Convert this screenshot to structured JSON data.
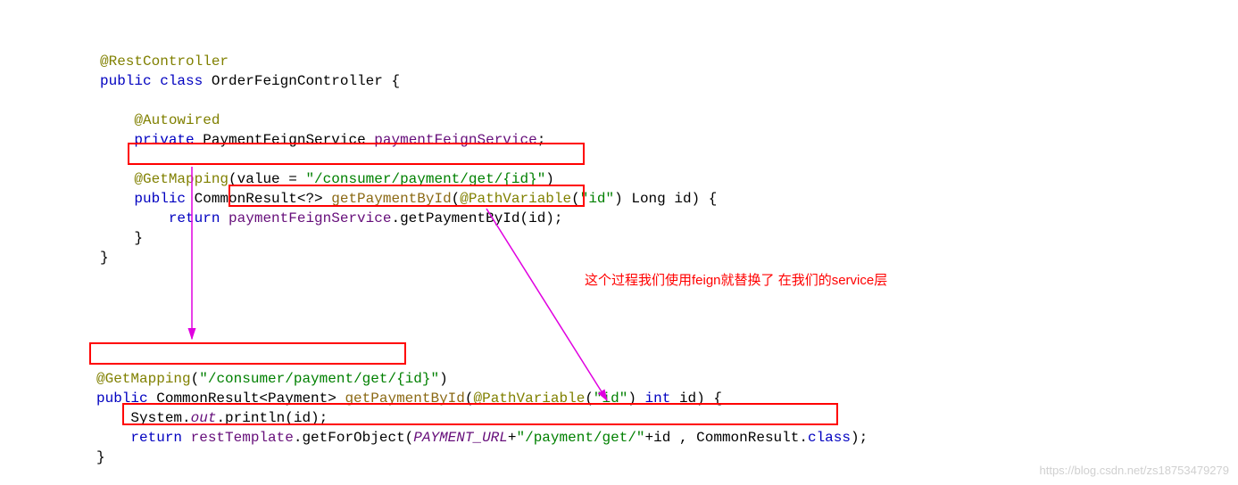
{
  "code1": {
    "line1": {
      "annotation": "@RestController"
    },
    "line2": {
      "kw1": "public",
      "kw2": "class",
      "name": "OrderFeignController",
      "brace": "{"
    },
    "line4": {
      "annotation": "@Autowired"
    },
    "line5": {
      "kw1": "private",
      "type": "PaymentFeignService",
      "field": "paymentFeignService",
      "semi": ";"
    },
    "line7": {
      "annotation": "@GetMapping",
      "paren1": "(",
      "param": "value = ",
      "string": "\"/consumer/payment/get/{id}\"",
      "paren2": ")"
    },
    "line8": {
      "kw1": "public",
      "type": "CommonResult<?> ",
      "method": "getPaymentById",
      "paren1": "(",
      "annotation": "@PathVariable",
      "pparen1": "(",
      "pstring": "\"id\"",
      "pparen2": ")",
      "argtype": " Long ",
      "argname": "id",
      "paren2": ") {"
    },
    "line9": {
      "kw1": "return",
      "sp": " ",
      "field": "paymentFeignService",
      "call": ".getPaymentById(id);"
    },
    "line10": {
      "brace": "}"
    },
    "line11": {
      "brace": "}"
    }
  },
  "comment": "这个过程我们使用feign就替换了 在我们的service层",
  "code2": {
    "line1": {
      "annotation": "@GetMapping",
      "paren1": "(",
      "string": "\"/consumer/payment/get/{id}\"",
      "paren2": ")"
    },
    "line2": {
      "kw1": "public",
      "type": " CommonResult<Payment> ",
      "method": "getPaymentById",
      "paren1": "(",
      "annotation": "@PathVariable",
      "pparen1": "(",
      "pstring": "\"id\"",
      "pparen2": ")",
      "kw2": " int ",
      "argname": "id",
      "paren2": ") {"
    },
    "line3": {
      "prefix": "System.",
      "out": "out",
      "call": ".println(id);"
    },
    "line4": {
      "kw1": "return",
      "sp": " ",
      "field": "restTemplate",
      "call1": ".getForObject(",
      "constant": "PAYMENT_URL",
      "plus1": "+",
      "string": "\"/payment/get/\"",
      "plus2": "+id , CommonResult.",
      "kw2": "class",
      "paren2": ");"
    },
    "line5": {
      "brace": "}"
    }
  },
  "watermark": "https://blog.csdn.net/zs18753479279"
}
